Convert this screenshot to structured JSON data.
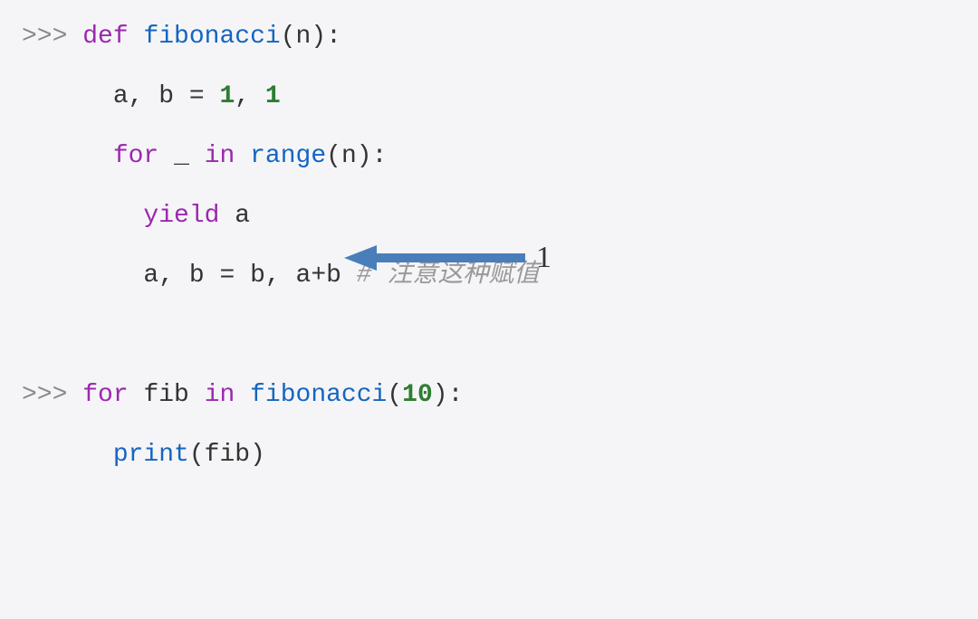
{
  "code": {
    "line1": {
      "prompt": ">>> ",
      "kw_def": "def",
      "fn_name": "fibonacci",
      "paren_open": "(",
      "param": "n",
      "paren_close": ")",
      "colon": ":"
    },
    "line2": {
      "indent": "      ",
      "a": "a",
      "comma1": ", ",
      "b": "b",
      "eq": " = ",
      "num1": "1",
      "comma2": ", ",
      "num2": "1"
    },
    "line3": {
      "indent": "      ",
      "kw_for": "for",
      "sp1": " ",
      "var": "_",
      "sp2": " ",
      "kw_in": "in",
      "sp3": " ",
      "builtin": "range",
      "paren_open": "(",
      "arg": "n",
      "paren_close": ")",
      "colon": ":"
    },
    "line4": {
      "indent": "        ",
      "kw_yield": "yield",
      "sp": " ",
      "var": "a"
    },
    "line5": {
      "indent": "        ",
      "a": "a",
      "comma1": ", ",
      "b": "b",
      "eq": " = ",
      "b2": "b",
      "comma2": ", ",
      "a2": "a",
      "plus": "+",
      "b3": "b",
      "sp": " ",
      "comment": "# 注意这种赋值"
    },
    "line6": {
      "prompt": ">>> ",
      "kw_for": "for",
      "sp1": " ",
      "var": "fib",
      "sp2": " ",
      "kw_in": "in",
      "sp3": " ",
      "fn": "fibonacci",
      "paren_open": "(",
      "arg": "10",
      "paren_close": ")",
      "colon": ":"
    },
    "line7": {
      "indent": "      ",
      "fn": "print",
      "paren_open": "(",
      "arg": "fib",
      "paren_close": ")"
    }
  },
  "annotation": {
    "value": "1",
    "arrow_color": "#4a7ebb"
  }
}
